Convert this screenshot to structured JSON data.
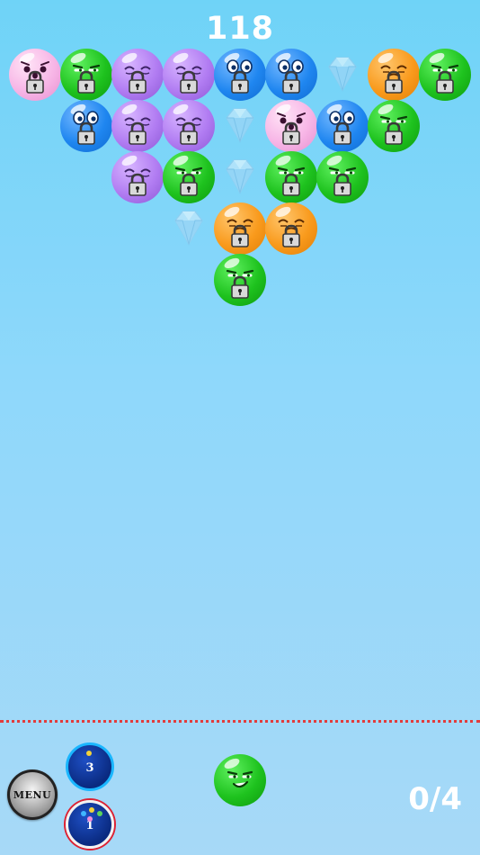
{
  "hud": {
    "score": "118",
    "progress": "0/4",
    "menu_label": "MENU"
  },
  "powerups": {
    "bomb": {
      "count": "3"
    },
    "rainbow": {
      "count": "1"
    }
  },
  "shooter": {
    "color": "green",
    "face": "smirk"
  },
  "colors": {
    "green": "#1ec21e",
    "purple": "#b17cf2",
    "blue": "#1f86f0",
    "pink": "#f7b5e6",
    "orange": "#f99a1c",
    "deadline": "#e23c3c"
  },
  "grid": {
    "rows": [
      [
        {
          "type": "pink",
          "face": "surprised",
          "locked": true
        },
        {
          "type": "green",
          "face": "smirk",
          "locked": true
        },
        {
          "type": "purple",
          "face": "sleepy",
          "locked": true
        },
        {
          "type": "purple",
          "face": "sleepy",
          "locked": true
        },
        {
          "type": "blue",
          "face": "wide",
          "locked": true
        },
        {
          "type": "blue",
          "face": "wide",
          "locked": true
        },
        {
          "type": "diamond",
          "face": "",
          "locked": false
        },
        {
          "type": "orange",
          "face": "squint",
          "locked": true
        },
        {
          "type": "green",
          "face": "smirk",
          "locked": true
        }
      ],
      [
        {
          "type": "blue",
          "face": "wide",
          "locked": true
        },
        {
          "type": "purple",
          "face": "sleepy",
          "locked": true
        },
        {
          "type": "purple",
          "face": "sleepy",
          "locked": true
        },
        {
          "type": "diamond",
          "face": "",
          "locked": false
        },
        {
          "type": "pink",
          "face": "surprised",
          "locked": true
        },
        {
          "type": "blue",
          "face": "wide",
          "locked": true
        },
        {
          "type": "green",
          "face": "smirk",
          "locked": true
        }
      ],
      [
        {
          "type": "purple",
          "face": "sleepy",
          "locked": true
        },
        {
          "type": "green",
          "face": "smirk",
          "locked": true
        },
        {
          "type": "diamond",
          "face": "",
          "locked": false
        },
        {
          "type": "green",
          "face": "smirk",
          "locked": true
        },
        {
          "type": "green",
          "face": "smirk",
          "locked": true
        }
      ],
      [
        {
          "type": "diamond",
          "face": "",
          "locked": false
        },
        {
          "type": "orange",
          "face": "squint",
          "locked": true
        },
        {
          "type": "orange",
          "face": "squint",
          "locked": true
        }
      ],
      [
        {
          "type": "green",
          "face": "smirk",
          "locked": true
        }
      ]
    ]
  }
}
